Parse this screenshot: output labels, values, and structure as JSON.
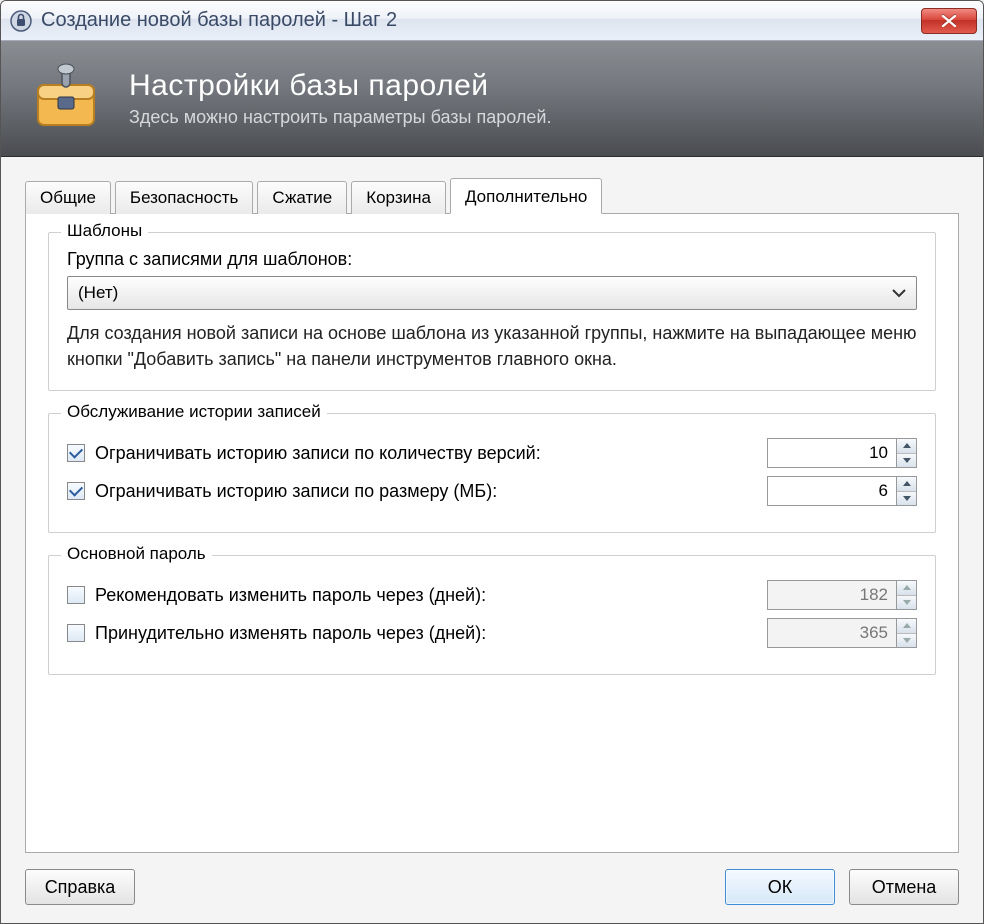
{
  "window": {
    "title": "Создание новой базы паролей - Шаг 2"
  },
  "banner": {
    "title": "Настройки базы паролей",
    "subtitle": "Здесь можно настроить параметры базы паролей."
  },
  "tabs": {
    "items": [
      {
        "label": "Общие"
      },
      {
        "label": "Безопасность"
      },
      {
        "label": "Сжатие"
      },
      {
        "label": "Корзина"
      },
      {
        "label": "Дополнительно"
      }
    ],
    "activeIndex": 4
  },
  "templates_group": {
    "title": "Шаблоны",
    "label": "Группа с записями для шаблонов:",
    "dropdown_value": "(Нет)",
    "description": "Для создания новой записи на основе шаблона из указанной группы, нажмите на выпадающее меню кнопки \"Добавить запись\" на панели инструментов главного окна."
  },
  "history_group": {
    "title": "Обслуживание истории записей",
    "limit_versions": {
      "label": "Ограничивать историю записи по количеству версий:",
      "checked": true,
      "value": "10"
    },
    "limit_size": {
      "label": "Ограничивать историю записи по размеру (МБ):",
      "checked": true,
      "value": "6"
    }
  },
  "password_group": {
    "title": "Основной пароль",
    "recommend_change": {
      "label": "Рекомендовать изменить пароль через (дней):",
      "checked": false,
      "value": "182"
    },
    "force_change": {
      "label": "Принудительно изменять пароль через (дней):",
      "checked": false,
      "value": "365"
    }
  },
  "footer": {
    "help": "Справка",
    "ok": "ОК",
    "cancel": "Отмена"
  }
}
